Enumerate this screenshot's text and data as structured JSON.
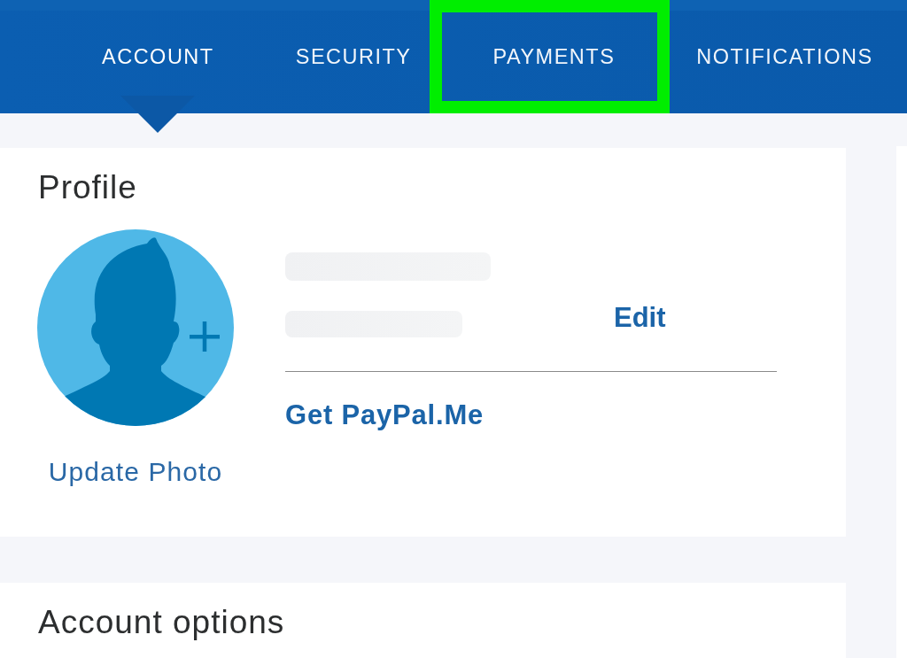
{
  "tabs": [
    {
      "label": "ACCOUNT",
      "selected": true,
      "highlighted": false
    },
    {
      "label": "SECURITY",
      "selected": false,
      "highlighted": false
    },
    {
      "label": "PAYMENTS",
      "selected": false,
      "highlighted": true
    },
    {
      "label": "NOTIFICATIONS",
      "selected": false,
      "highlighted": false
    }
  ],
  "profile": {
    "title": "Profile",
    "photo_link": "Update Photo",
    "blurred_lines": [
      {
        "kind": "name"
      },
      {
        "kind": "detail"
      }
    ],
    "edit_link": "Edit",
    "paypal_me_link": "Get PayPal.Me"
  },
  "account_options": {
    "title": "Account options"
  }
}
